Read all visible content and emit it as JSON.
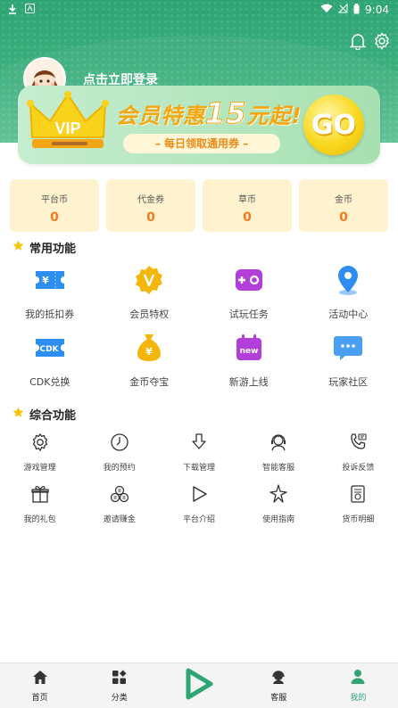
{
  "status_bar": {
    "time": "9:04"
  },
  "header": {
    "login_text": "点击立即登录"
  },
  "vip_banner": {
    "badge": "VIP",
    "title_prefix": "会员特惠",
    "title_number": "15",
    "title_suffix": "元起!",
    "subtitle": "– 每日领取通用券 –",
    "go_label": "GO"
  },
  "currencies": [
    {
      "label": "平台币",
      "value": "0"
    },
    {
      "label": "代金券",
      "value": "0"
    },
    {
      "label": "草币",
      "value": "0"
    },
    {
      "label": "金币",
      "value": "0"
    }
  ],
  "common_section": {
    "title": "常用功能",
    "items": [
      {
        "label": "我的抵扣券",
        "icon": "voucher-icon"
      },
      {
        "label": "会员特权",
        "icon": "vip-badge-icon"
      },
      {
        "label": "试玩任务",
        "icon": "gamepad-icon"
      },
      {
        "label": "活动中心",
        "icon": "location-pin-icon"
      },
      {
        "label": "CDK兑换",
        "icon": "cdk-ticket-icon",
        "badge": "CDK"
      },
      {
        "label": "金币夺宝",
        "icon": "money-bag-icon"
      },
      {
        "label": "新游上线",
        "icon": "new-game-calendar-icon",
        "badge": "new"
      },
      {
        "label": "玩家社区",
        "icon": "chat-bubble-icon"
      }
    ]
  },
  "general_section": {
    "title": "综合功能",
    "items": [
      {
        "label": "游戏管理",
        "icon": "gear-icon"
      },
      {
        "label": "我的预约",
        "icon": "clock-icon"
      },
      {
        "label": "下载管理",
        "icon": "download-arrow-icon"
      },
      {
        "label": "智能客服",
        "icon": "customer-service-icon"
      },
      {
        "label": "投诉反馈",
        "icon": "phone-feedback-icon"
      },
      {
        "label": "我的礼包",
        "icon": "gift-icon"
      },
      {
        "label": "邀请赚金",
        "icon": "coins-icon"
      },
      {
        "label": "平台介绍",
        "icon": "play-icon"
      },
      {
        "label": "使用指南",
        "icon": "sparkle-icon"
      },
      {
        "label": "货币明细",
        "icon": "receipt-icon"
      }
    ]
  },
  "bottom_nav": [
    {
      "label": "首页",
      "icon": "home-icon"
    },
    {
      "label": "分类",
      "icon": "category-icon"
    },
    {
      "label": "",
      "icon": "play-triangle-icon"
    },
    {
      "label": "客服",
      "icon": "headset-icon"
    },
    {
      "label": "我的",
      "icon": "user-icon",
      "active": true
    }
  ],
  "colors": {
    "brand_green": "#2fa574",
    "card_bg": "#fff3cf",
    "value_orange": "#f07a1d",
    "star_yellow": "#f7c300"
  }
}
